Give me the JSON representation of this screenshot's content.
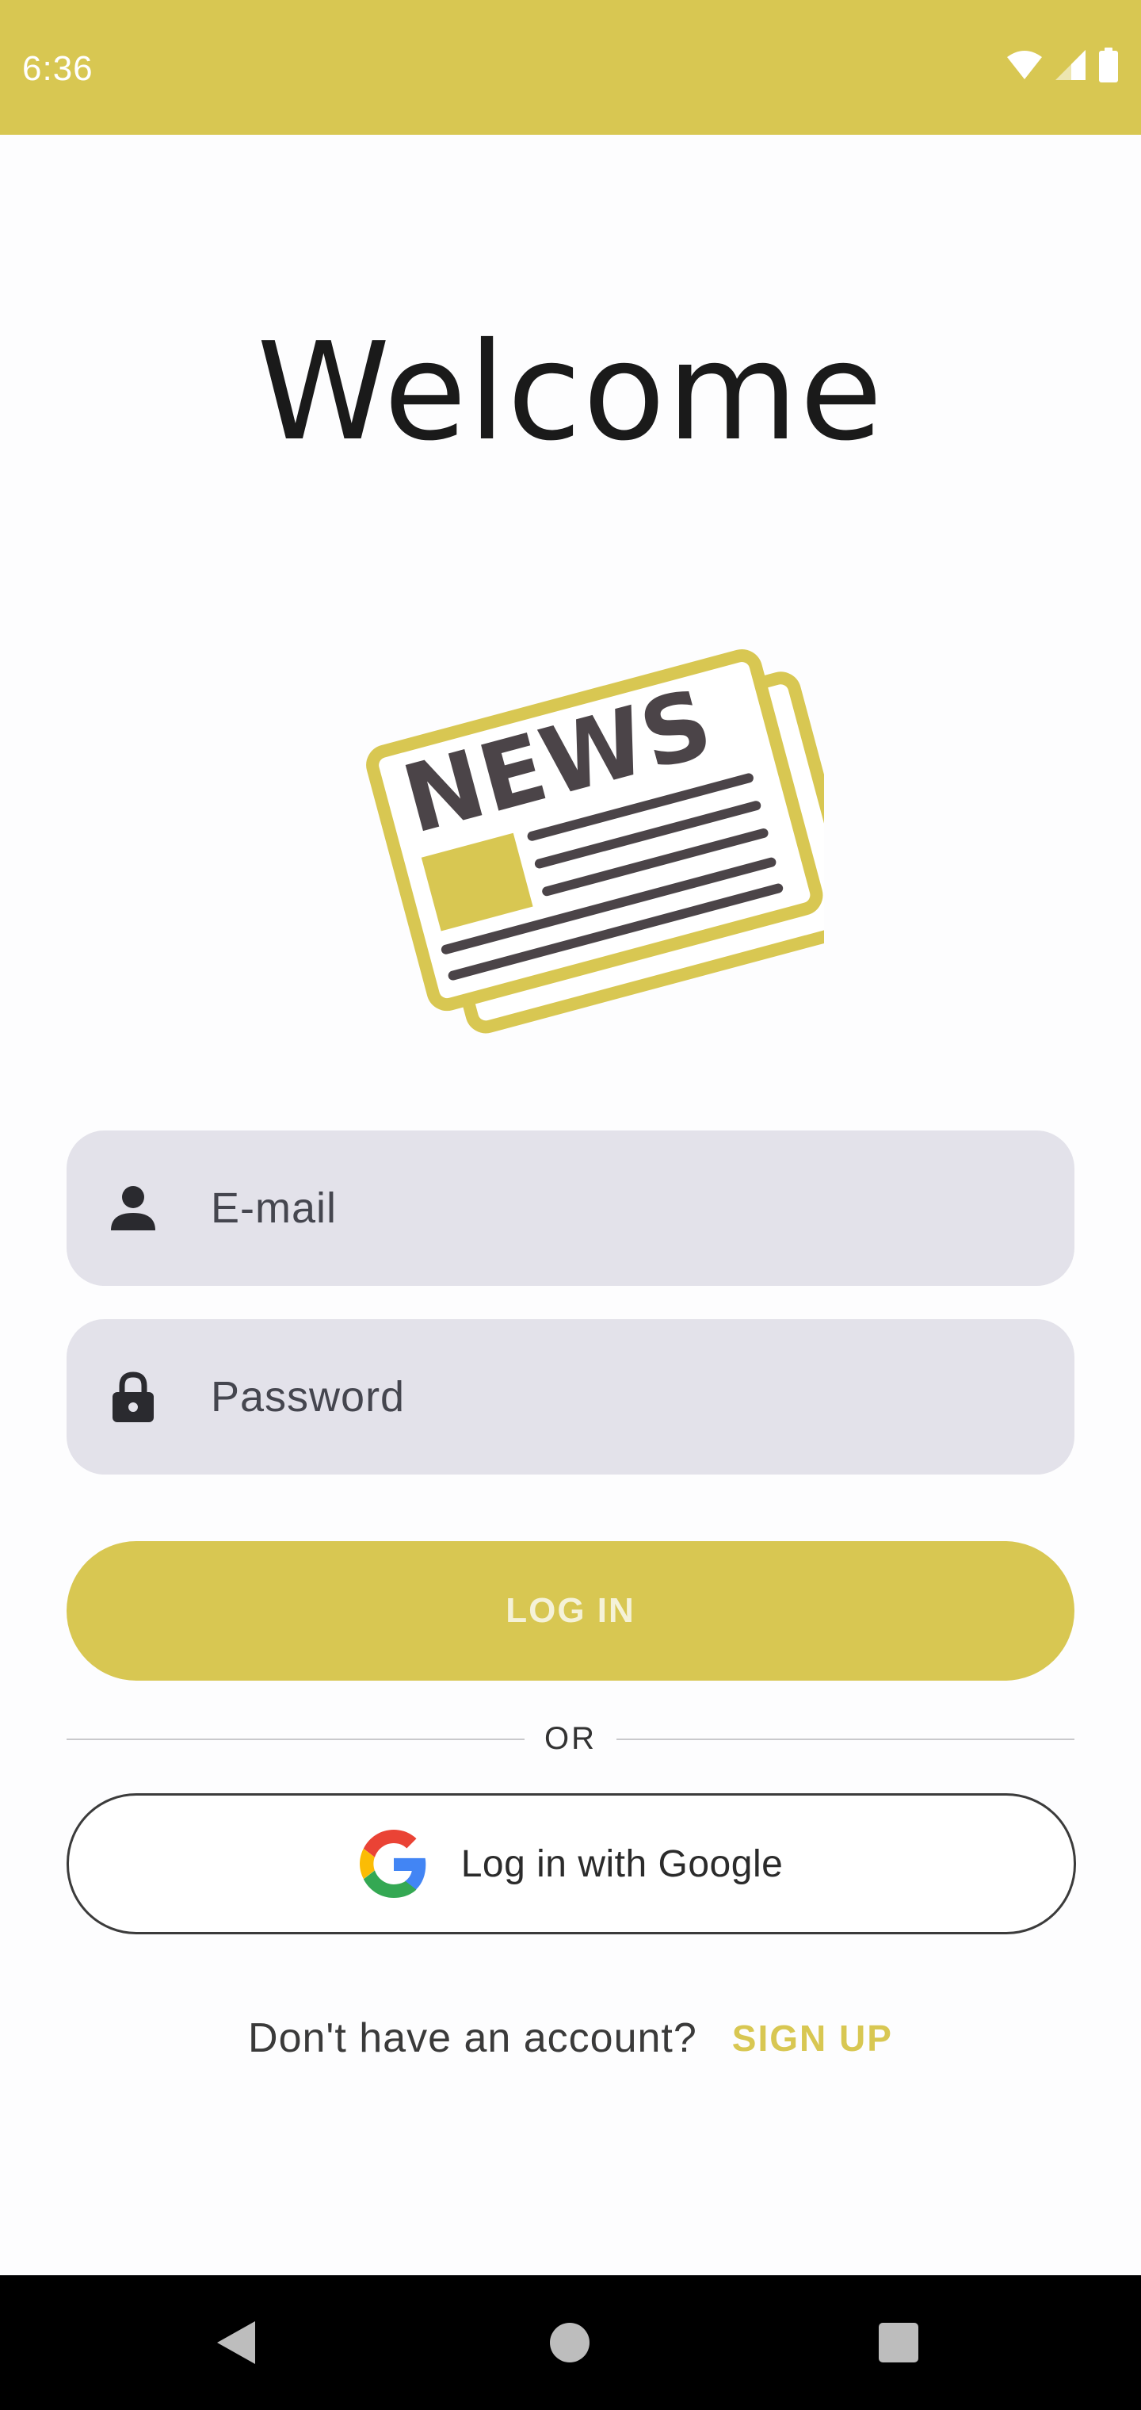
{
  "status_bar": {
    "time": "6:36",
    "background": "#d8c752"
  },
  "header": {
    "title": "Welcome"
  },
  "logo": {
    "text": "NEWS",
    "accent": "#d8c752",
    "ink": "#4b4448"
  },
  "form": {
    "email": {
      "placeholder": "E-mail",
      "value": "",
      "icon": "person-icon"
    },
    "password": {
      "placeholder": "Password",
      "value": "",
      "icon": "lock-icon"
    },
    "login_label": "LOG IN",
    "divider_label": "OR",
    "google_label": "Log in with Google"
  },
  "footer": {
    "prompt": "Don't have an account?",
    "signup_label": "SIGN UP"
  },
  "nav": {
    "icons": [
      "back-icon",
      "home-icon",
      "recents-icon"
    ]
  }
}
